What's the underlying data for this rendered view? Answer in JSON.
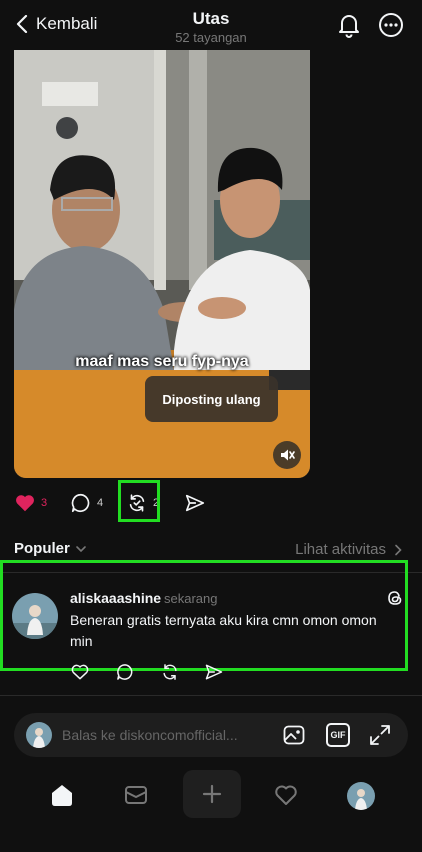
{
  "header": {
    "back_label": "Kembali",
    "title": "Utas",
    "subtitle": "52 tayangan"
  },
  "post": {
    "caption": "maaf mas seru fyp-nya",
    "toast": "Diposting ulang",
    "likes": "3",
    "replies": "4",
    "reposts": "2"
  },
  "replies_section": {
    "sort_label": "Populer",
    "activity_link": "Lihat aktivitas"
  },
  "comment": {
    "username": "aliskaaashine",
    "time": "sekarang",
    "text": "Beneran gratis ternyata aku kira cmn omon omon min"
  },
  "reply_bar": {
    "placeholder": "Balas ke diskoncomofficial...",
    "gif_label": "GIF"
  },
  "colors": {
    "accent_like": "#e0245e",
    "highlight": "#22dd22",
    "background": "#101010"
  },
  "icons": [
    "chevron-left-icon",
    "bell-icon",
    "more-icon",
    "heart-icon",
    "comment-icon",
    "repost-icon",
    "send-icon",
    "mute-icon",
    "threads-icon",
    "image-icon",
    "gif-icon",
    "expand-icon",
    "home-icon",
    "inbox-icon",
    "plus-icon",
    "activity-heart-icon"
  ]
}
